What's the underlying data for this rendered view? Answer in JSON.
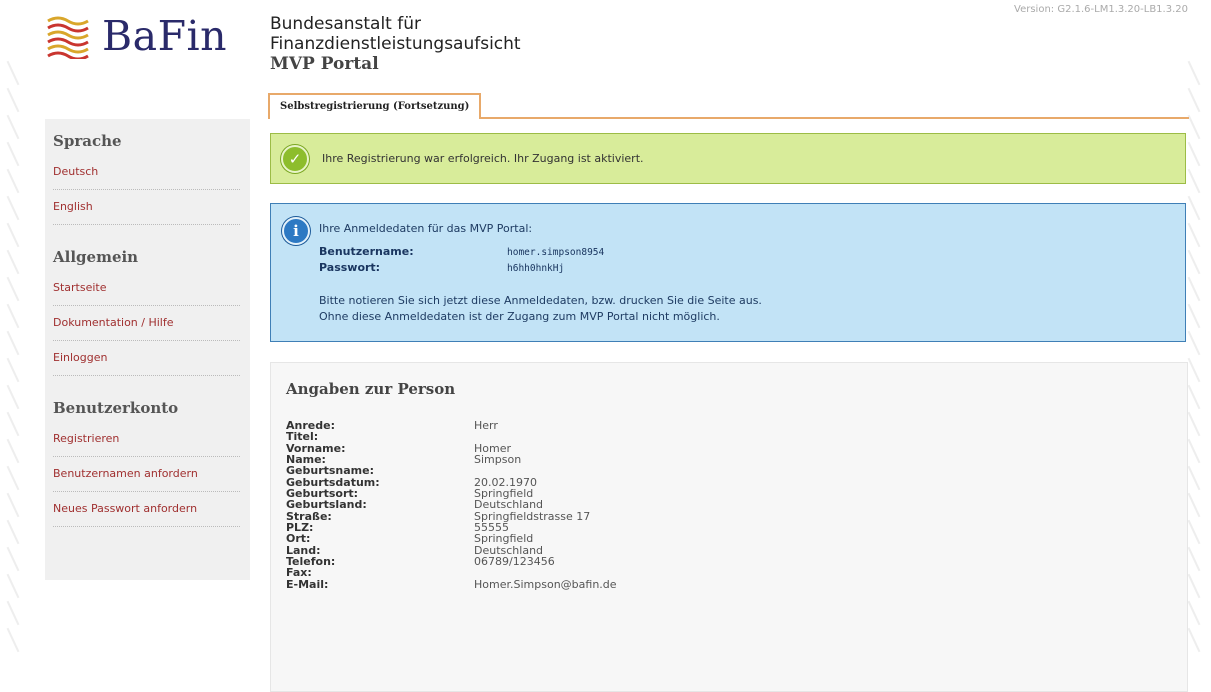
{
  "header": {
    "logo_text": "BaFin",
    "agency_line1": "Bundesanstalt für",
    "agency_line2": "Finanzdienstleistungsaufsicht",
    "portal": "MVP Portal",
    "version": "Version: G2.1.6-LM1.3.20-LB1.3.20"
  },
  "tabs": [
    {
      "label": "Selbstregistrierung (Fortsetzung)",
      "active": true
    }
  ],
  "sidebar": {
    "sections": [
      {
        "title": "Sprache",
        "items": [
          "Deutsch",
          "English"
        ]
      },
      {
        "title": "Allgemein",
        "items": [
          "Startseite",
          "Dokumentation / Hilfe",
          "Einloggen"
        ]
      },
      {
        "title": "Benutzerkonto",
        "items": [
          "Registrieren",
          "Benutzernamen anfordern",
          "Neues Passwort anfordern"
        ]
      }
    ]
  },
  "success": {
    "icon": "check-icon",
    "message": "Ihre Registrierung war erfolgreich. Ihr Zugang ist aktiviert."
  },
  "info": {
    "icon": "info-icon",
    "intro": "Ihre Anmeldedaten für das MVP Portal:",
    "username_label": "Benutzername:",
    "username_value": "homer.simpson8954",
    "password_label": "Passwort:",
    "password_value": "h6hh0hnkHj",
    "note_line1": "Bitte notieren Sie sich jetzt diese Anmeldedaten, bzw. drucken Sie die Seite aus.",
    "note_line2": "Ohne diese Anmeldedaten ist der Zugang zum MVP Portal nicht möglich."
  },
  "person": {
    "title": "Angaben zur Person",
    "rows": [
      {
        "label": "Anrede:",
        "value": "Herr"
      },
      {
        "label": "Titel:",
        "value": ""
      },
      {
        "label": "Vorname:",
        "value": "Homer"
      },
      {
        "label": "Name:",
        "value": "Simpson"
      },
      {
        "label": "Geburtsname:",
        "value": ""
      },
      {
        "label": "Geburtsdatum:",
        "value": "20.02.1970"
      },
      {
        "label": "Geburtsort:",
        "value": "Springfield"
      },
      {
        "label": "Geburtsland:",
        "value": "Deutschland"
      },
      {
        "label": "Straße:",
        "value": "Springfieldstrasse 17"
      },
      {
        "label": "PLZ:",
        "value": "55555"
      },
      {
        "label": "Ort:",
        "value": "Springfield"
      },
      {
        "label": "Land:",
        "value": "Deutschland"
      },
      {
        "label": "Telefon:",
        "value": "06789/123456"
      },
      {
        "label": "Fax:",
        "value": ""
      },
      {
        "label": "E-Mail:",
        "value": "Homer.Simpson@bafin.de"
      }
    ]
  },
  "colors": {
    "link": "#a03030",
    "tab_border": "#e8a96a",
    "success_bg": "#d8ec9a",
    "info_bg": "#c2e3f6",
    "brand": "#2a2a6a"
  }
}
